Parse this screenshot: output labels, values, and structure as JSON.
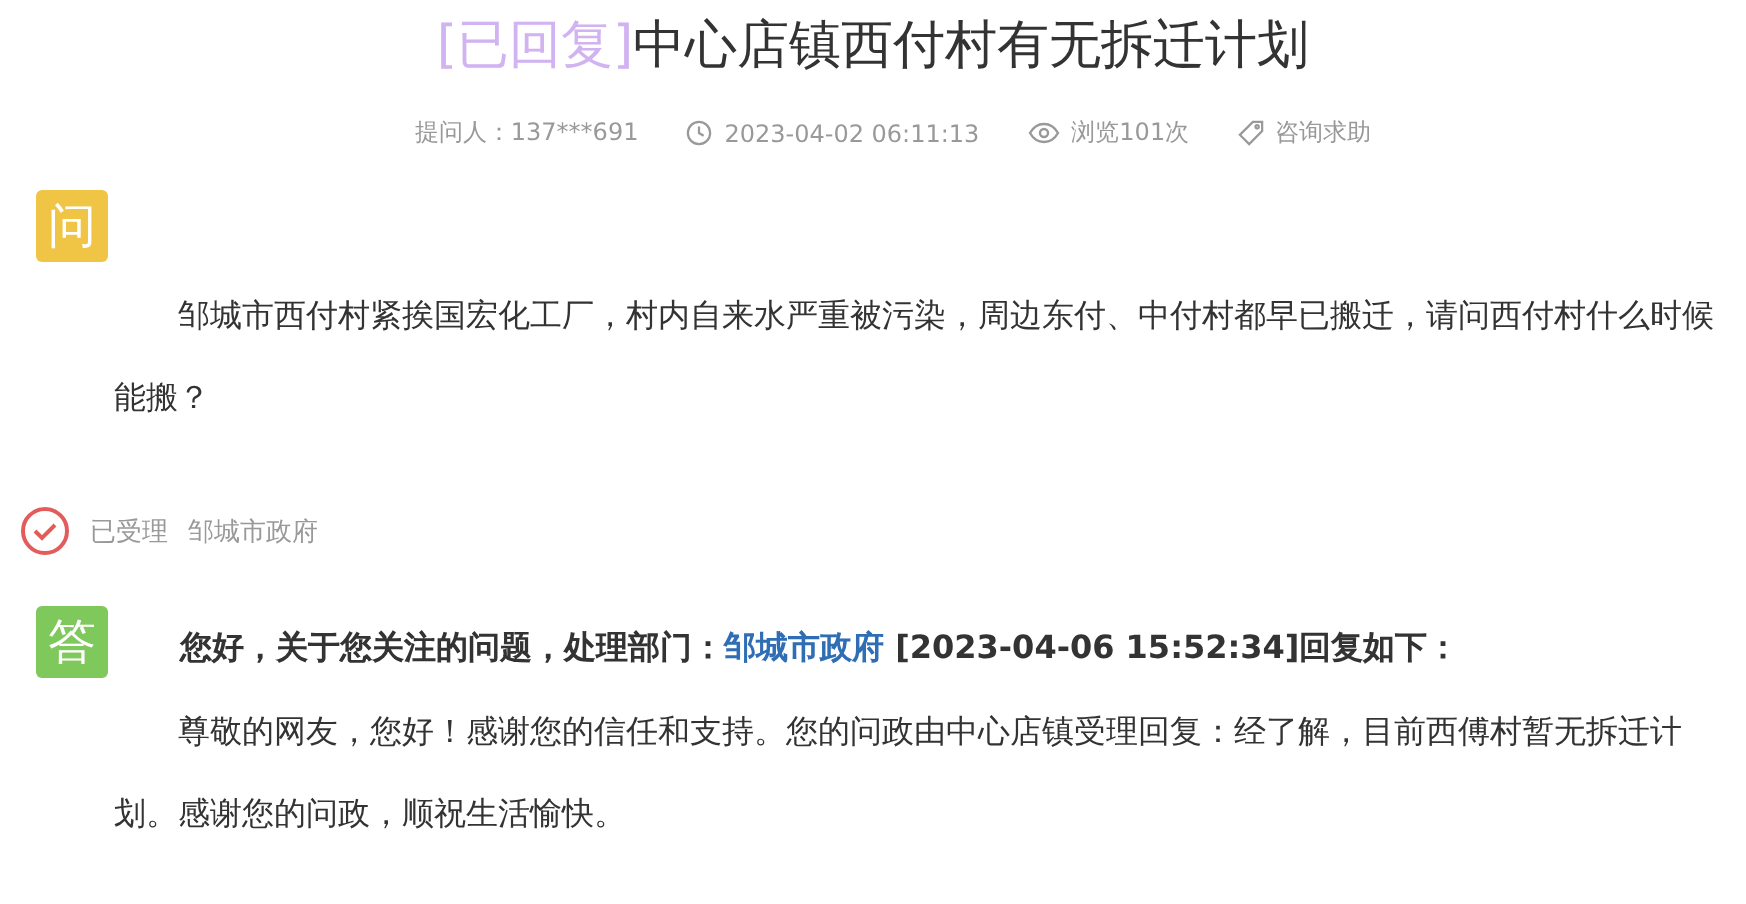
{
  "title": {
    "status": "[已回复]",
    "text": "中心店镇西付村有无拆迁计划"
  },
  "meta": [
    {
      "kind": "asker",
      "text": "提问人：137***691"
    },
    {
      "kind": "time",
      "text": "2023-04-02 06:11:13"
    },
    {
      "kind": "views",
      "text": "浏览101次"
    },
    {
      "kind": "category",
      "text": "咨询求助"
    }
  ],
  "question": {
    "badge": "问",
    "text": "邹城市西付村紧挨国宏化工厂，村内自来水严重被污染，周边东付、中付村都早已搬迁，请问西付村什么时候能搬？"
  },
  "status_row": {
    "state": "已受理",
    "department": "邹城市政府"
  },
  "answer": {
    "badge": "答",
    "header_prefix": "您好，关于您关注的问题，处理部门：",
    "department": "邹城市政府",
    "header_suffix": " [2023-04-06 15:52:34]回复如下：",
    "text": "尊敬的网友，您好！感谢您的信任和支持。您的问政由中心店镇受理回复：经了解，目前西傅村暂无拆迁计划。感谢您的问政，顺祝生活愉快。"
  }
}
